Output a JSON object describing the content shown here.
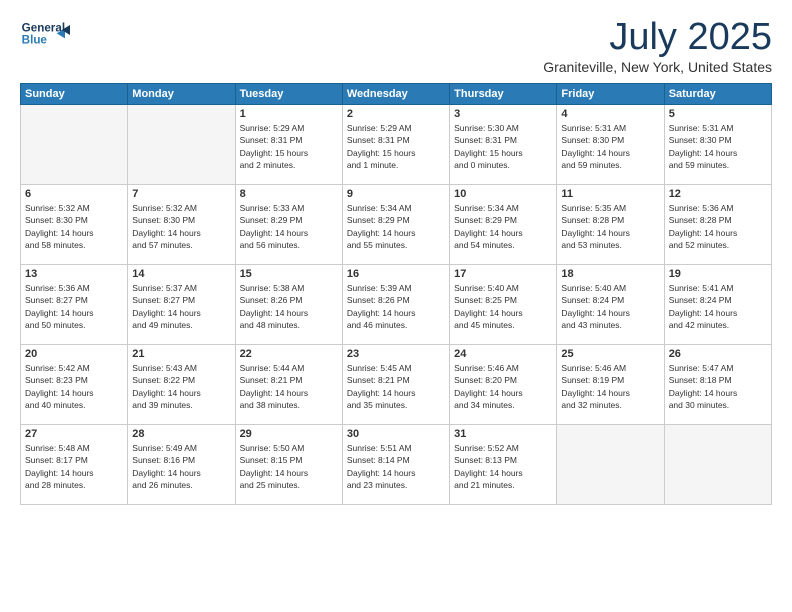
{
  "header": {
    "logo_line1": "General",
    "logo_line2": "Blue",
    "month_title": "July 2025",
    "location": "Graniteville, New York, United States"
  },
  "weekdays": [
    "Sunday",
    "Monday",
    "Tuesday",
    "Wednesday",
    "Thursday",
    "Friday",
    "Saturday"
  ],
  "weeks": [
    [
      {
        "day": "",
        "info": ""
      },
      {
        "day": "",
        "info": ""
      },
      {
        "day": "1",
        "info": "Sunrise: 5:29 AM\nSunset: 8:31 PM\nDaylight: 15 hours\nand 2 minutes."
      },
      {
        "day": "2",
        "info": "Sunrise: 5:29 AM\nSunset: 8:31 PM\nDaylight: 15 hours\nand 1 minute."
      },
      {
        "day": "3",
        "info": "Sunrise: 5:30 AM\nSunset: 8:31 PM\nDaylight: 15 hours\nand 0 minutes."
      },
      {
        "day": "4",
        "info": "Sunrise: 5:31 AM\nSunset: 8:30 PM\nDaylight: 14 hours\nand 59 minutes."
      },
      {
        "day": "5",
        "info": "Sunrise: 5:31 AM\nSunset: 8:30 PM\nDaylight: 14 hours\nand 59 minutes."
      }
    ],
    [
      {
        "day": "6",
        "info": "Sunrise: 5:32 AM\nSunset: 8:30 PM\nDaylight: 14 hours\nand 58 minutes."
      },
      {
        "day": "7",
        "info": "Sunrise: 5:32 AM\nSunset: 8:30 PM\nDaylight: 14 hours\nand 57 minutes."
      },
      {
        "day": "8",
        "info": "Sunrise: 5:33 AM\nSunset: 8:29 PM\nDaylight: 14 hours\nand 56 minutes."
      },
      {
        "day": "9",
        "info": "Sunrise: 5:34 AM\nSunset: 8:29 PM\nDaylight: 14 hours\nand 55 minutes."
      },
      {
        "day": "10",
        "info": "Sunrise: 5:34 AM\nSunset: 8:29 PM\nDaylight: 14 hours\nand 54 minutes."
      },
      {
        "day": "11",
        "info": "Sunrise: 5:35 AM\nSunset: 8:28 PM\nDaylight: 14 hours\nand 53 minutes."
      },
      {
        "day": "12",
        "info": "Sunrise: 5:36 AM\nSunset: 8:28 PM\nDaylight: 14 hours\nand 52 minutes."
      }
    ],
    [
      {
        "day": "13",
        "info": "Sunrise: 5:36 AM\nSunset: 8:27 PM\nDaylight: 14 hours\nand 50 minutes."
      },
      {
        "day": "14",
        "info": "Sunrise: 5:37 AM\nSunset: 8:27 PM\nDaylight: 14 hours\nand 49 minutes."
      },
      {
        "day": "15",
        "info": "Sunrise: 5:38 AM\nSunset: 8:26 PM\nDaylight: 14 hours\nand 48 minutes."
      },
      {
        "day": "16",
        "info": "Sunrise: 5:39 AM\nSunset: 8:26 PM\nDaylight: 14 hours\nand 46 minutes."
      },
      {
        "day": "17",
        "info": "Sunrise: 5:40 AM\nSunset: 8:25 PM\nDaylight: 14 hours\nand 45 minutes."
      },
      {
        "day": "18",
        "info": "Sunrise: 5:40 AM\nSunset: 8:24 PM\nDaylight: 14 hours\nand 43 minutes."
      },
      {
        "day": "19",
        "info": "Sunrise: 5:41 AM\nSunset: 8:24 PM\nDaylight: 14 hours\nand 42 minutes."
      }
    ],
    [
      {
        "day": "20",
        "info": "Sunrise: 5:42 AM\nSunset: 8:23 PM\nDaylight: 14 hours\nand 40 minutes."
      },
      {
        "day": "21",
        "info": "Sunrise: 5:43 AM\nSunset: 8:22 PM\nDaylight: 14 hours\nand 39 minutes."
      },
      {
        "day": "22",
        "info": "Sunrise: 5:44 AM\nSunset: 8:21 PM\nDaylight: 14 hours\nand 38 minutes."
      },
      {
        "day": "23",
        "info": "Sunrise: 5:45 AM\nSunset: 8:21 PM\nDaylight: 14 hours\nand 35 minutes."
      },
      {
        "day": "24",
        "info": "Sunrise: 5:46 AM\nSunset: 8:20 PM\nDaylight: 14 hours\nand 34 minutes."
      },
      {
        "day": "25",
        "info": "Sunrise: 5:46 AM\nSunset: 8:19 PM\nDaylight: 14 hours\nand 32 minutes."
      },
      {
        "day": "26",
        "info": "Sunrise: 5:47 AM\nSunset: 8:18 PM\nDaylight: 14 hours\nand 30 minutes."
      }
    ],
    [
      {
        "day": "27",
        "info": "Sunrise: 5:48 AM\nSunset: 8:17 PM\nDaylight: 14 hours\nand 28 minutes."
      },
      {
        "day": "28",
        "info": "Sunrise: 5:49 AM\nSunset: 8:16 PM\nDaylight: 14 hours\nand 26 minutes."
      },
      {
        "day": "29",
        "info": "Sunrise: 5:50 AM\nSunset: 8:15 PM\nDaylight: 14 hours\nand 25 minutes."
      },
      {
        "day": "30",
        "info": "Sunrise: 5:51 AM\nSunset: 8:14 PM\nDaylight: 14 hours\nand 23 minutes."
      },
      {
        "day": "31",
        "info": "Sunrise: 5:52 AM\nSunset: 8:13 PM\nDaylight: 14 hours\nand 21 minutes."
      },
      {
        "day": "",
        "info": ""
      },
      {
        "day": "",
        "info": ""
      }
    ]
  ]
}
